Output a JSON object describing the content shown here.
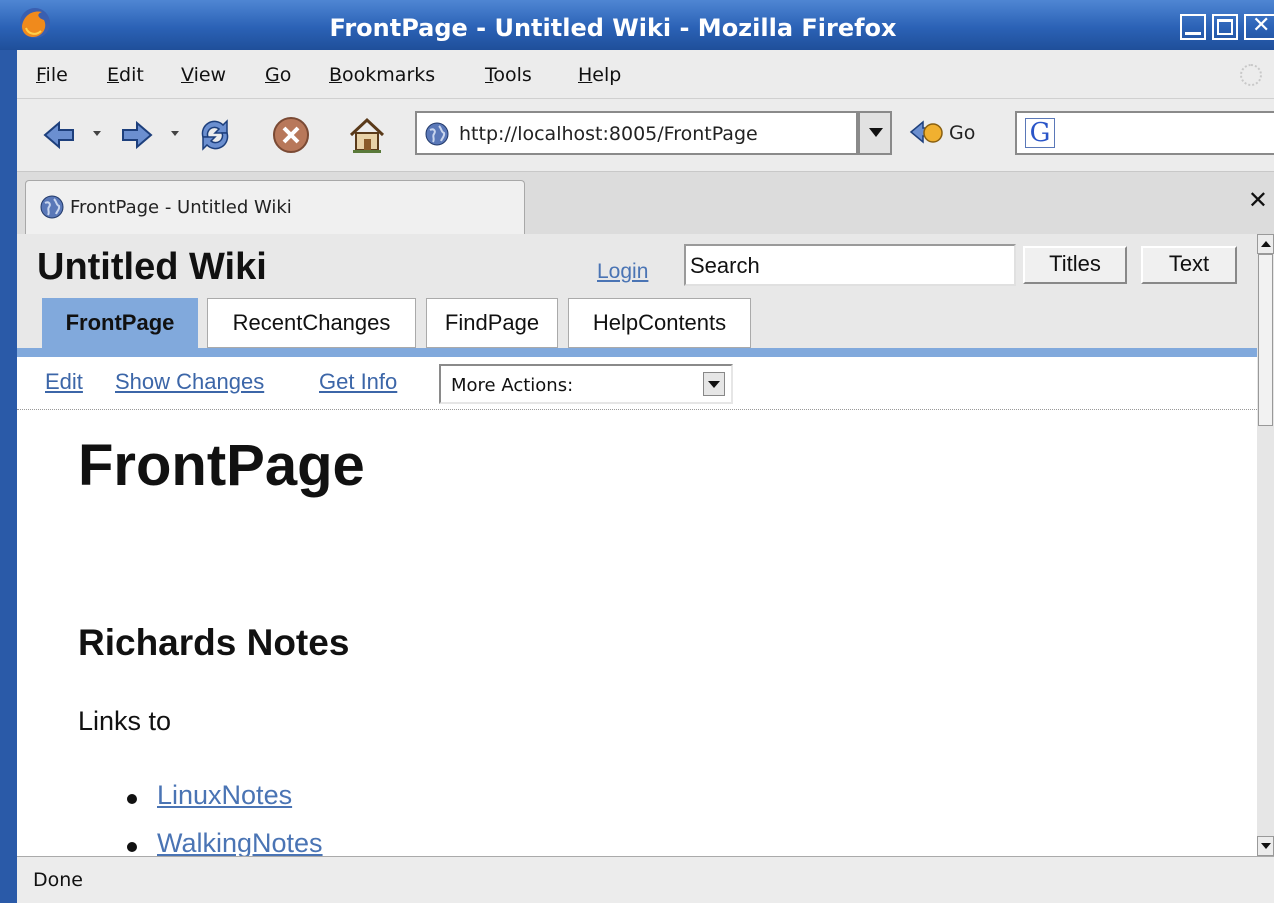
{
  "window": {
    "title": "FrontPage - Untitled Wiki - Mozilla Firefox"
  },
  "menubar": {
    "items": [
      {
        "label": "File",
        "mnemonic": "F",
        "rest": "ile"
      },
      {
        "label": "Edit",
        "mnemonic": "E",
        "rest": "dit"
      },
      {
        "label": "View",
        "mnemonic": "V",
        "rest": "iew"
      },
      {
        "label": "Go",
        "mnemonic": "G",
        "rest": "o"
      },
      {
        "label": "Bookmarks",
        "mnemonic": "B",
        "rest": "ookmarks"
      },
      {
        "label": "Tools",
        "mnemonic": "T",
        "rest": "ools"
      },
      {
        "label": "Help",
        "mnemonic": "H",
        "rest": "elp"
      }
    ]
  },
  "navbar": {
    "url": "http://localhost:8005/FrontPage",
    "go_label": "Go",
    "icons": [
      "back-icon",
      "forward-icon",
      "reload-icon",
      "stop-icon",
      "home-icon",
      "globe-icon",
      "google-icon"
    ]
  },
  "tabs": [
    {
      "label": "FrontPage - Untitled Wiki"
    }
  ],
  "wiki": {
    "site_name": "Untitled Wiki",
    "login": "Login",
    "search_value": "Search",
    "titles_button": "Titles",
    "text_button": "Text",
    "nav_tabs": [
      {
        "label": "FrontPage",
        "active": true
      },
      {
        "label": "RecentChanges",
        "active": false
      },
      {
        "label": "FindPage",
        "active": false
      },
      {
        "label": "HelpContents",
        "active": false
      }
    ],
    "actions": {
      "edit": "Edit",
      "show_changes": "Show Changes",
      "get_info": "Get Info",
      "more_actions": "More Actions:"
    },
    "page": {
      "title": "FrontPage",
      "heading": "Richards Notes",
      "paragraph": "Links to",
      "links": [
        "LinuxNotes",
        "WalkingNotes"
      ]
    }
  },
  "status": {
    "text": "Done"
  },
  "colors": {
    "titlebar": "#2b62b6",
    "wiki_accent": "#81a9dc",
    "link": "#4a74b4"
  }
}
